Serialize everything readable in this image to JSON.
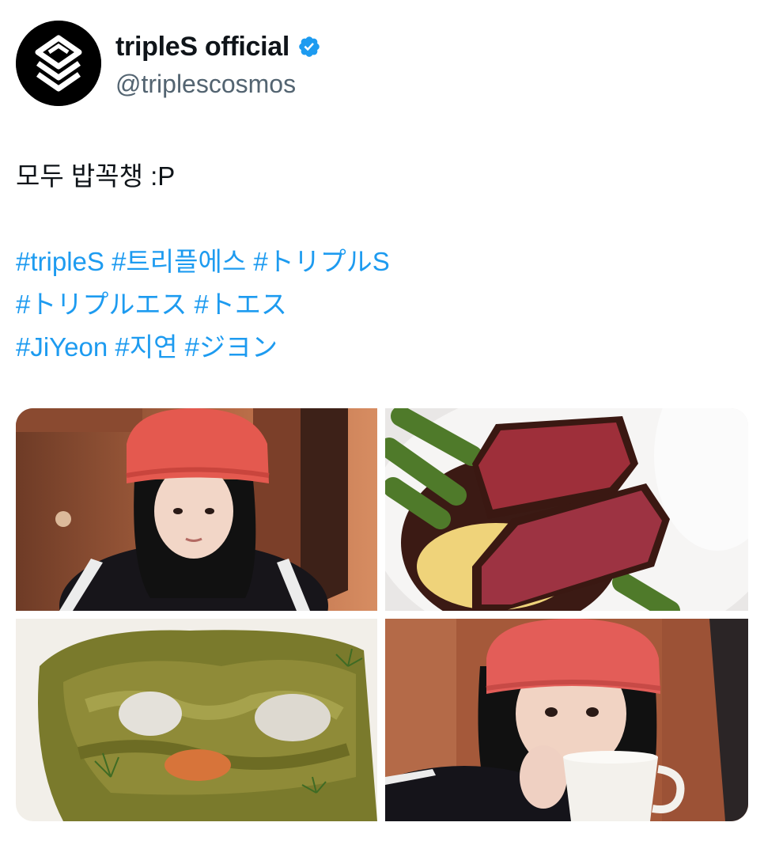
{
  "account": {
    "display_name": "tripleS official",
    "handle": "@triplescosmos",
    "verified": true,
    "avatar_icon": "triples-logo-icon",
    "verified_icon": "verified-badge-icon"
  },
  "tweet": {
    "text": "모두 밥꼭챙 :P",
    "hashtags": {
      "line1": [
        "#tripleS",
        "#트리플에스",
        "#トリプルS"
      ],
      "line2": [
        "#トリプルエス",
        "#トエス"
      ],
      "line3": [
        "#JiYeon",
        "#지연",
        "#ジヨン"
      ]
    }
  },
  "media": [
    {
      "kind": "selfie-red-beanie"
    },
    {
      "kind": "steak-asparagus"
    },
    {
      "kind": "pasta-green-sauce"
    },
    {
      "kind": "selfie-drinking-cup"
    }
  ],
  "colors": {
    "link": "#1d9bf0",
    "text": "#0f1419",
    "secondary": "#536471",
    "verified": "#1d9bf0"
  }
}
